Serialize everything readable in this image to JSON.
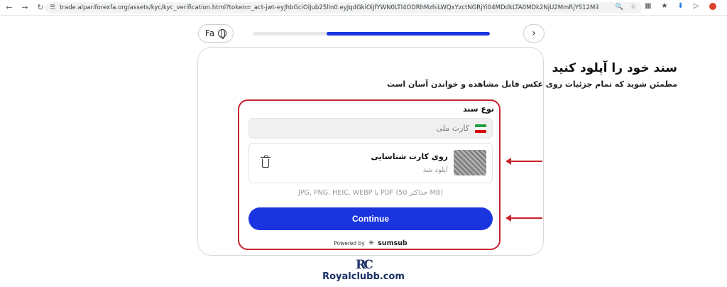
{
  "browser": {
    "url": "trade.alpariforexfa.org/assets/kyc/kyc_verification.html?token=_act-jwt-eyJhbGciOiJub25lIn0.eyJqdGkiOiJfYWN0LTI4ODRhMzhiLWQxYzctNGRjYi04MDdkLTA0MDk2NjU2MmRjYS12MilsInVybCI6Imh0dHBzOi8vYXBpLnN1YnN1Yi5jb2..."
  },
  "header": {
    "lang_label": "Fa",
    "progress_fraction": 0.69
  },
  "card": {
    "title": "سند خود را آپلود کنید",
    "subtitle": "مطمئن شوید که تمام جزئیات روی عکس قابل مشاهده و خواندن آسان است",
    "doc_type_label": "نوع سند",
    "doc_type_value": "کارت ملی",
    "upload_title": "روی کارت شناسایی",
    "upload_status": "آپلود شد",
    "formats": "JPG, PNG, HEIC, WEBP یا PDF (حداکثر 50 MB)",
    "continue_label": "Continue",
    "powered_by": "Powered by",
    "powered_brand": "sumsub"
  },
  "colors": {
    "accent": "#1a34e0",
    "highlight": "#c8232b",
    "flag_green": "#239f40",
    "flag_white": "#ffffff",
    "flag_red": "#da0000"
  },
  "watermark": {
    "mark": "RC",
    "text": "Royalclubb.com"
  }
}
